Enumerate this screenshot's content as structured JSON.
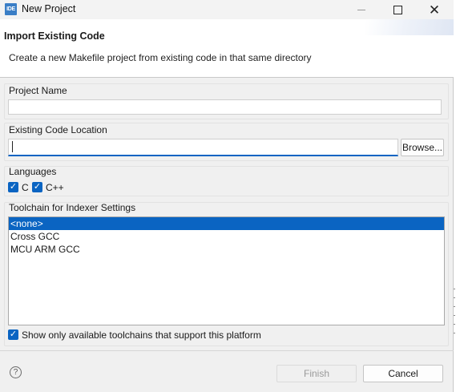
{
  "window": {
    "icon_text": "IDE",
    "title": "New Project"
  },
  "header": {
    "title": "Import Existing Code",
    "description": "Create a new Makefile project from existing code in that same directory"
  },
  "project_name": {
    "label": "Project Name",
    "value": ""
  },
  "code_location": {
    "label": "Existing Code Location",
    "value": "",
    "browse_label": "Browse..."
  },
  "languages": {
    "label": "Languages",
    "items": [
      {
        "label": "C",
        "checked": true
      },
      {
        "label": "C++",
        "checked": true
      }
    ]
  },
  "toolchain": {
    "label": "Toolchain for Indexer Settings",
    "items": [
      "<none>",
      "Cross GCC",
      "MCU ARM GCC"
    ],
    "selected_index": 0,
    "show_only_label": "Show only available toolchains that support this platform",
    "show_only_checked": true
  },
  "footer": {
    "help_symbol": "?",
    "finish_label": "Finish",
    "cancel_label": "Cancel"
  },
  "colors": {
    "accent": "#0a64c2"
  }
}
